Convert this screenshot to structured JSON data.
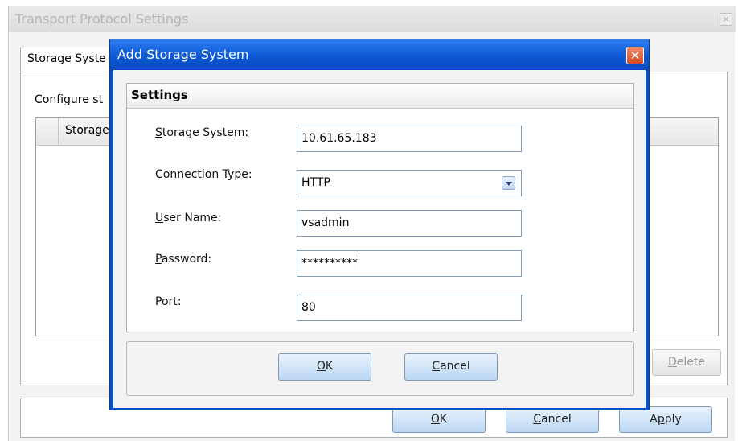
{
  "outer_window": {
    "title": "Transport Protocol Settings",
    "close_glyph": "×",
    "tab_label": "Storage Syste",
    "configure_text": "Configure st",
    "column_header": "Storage",
    "delete_label": "Delete",
    "ok_label": "OK",
    "cancel_label": "Cancel",
    "apply_label": "Apply"
  },
  "dialog": {
    "title": "Add Storage System",
    "close_glyph": "✕",
    "section_title": "Settings",
    "fields": {
      "storage_system": {
        "label_pre": "",
        "label_key": "S",
        "label_post": "torage System:",
        "value": "10.61.65.183"
      },
      "connection_type": {
        "label_pre": "Connection ",
        "label_key": "T",
        "label_post": "ype:",
        "value": "HTTP"
      },
      "user_name": {
        "label_pre": "",
        "label_key": "U",
        "label_post": "ser Name:",
        "value": "vsadmin"
      },
      "password": {
        "label_pre": "",
        "label_key": "P",
        "label_post": "assword:",
        "value": "**********"
      },
      "port": {
        "label_pre": "Port:",
        "label_key": "",
        "label_post": "",
        "value": "80"
      }
    },
    "ok_label": "OK",
    "cancel_label": "Cancel"
  }
}
